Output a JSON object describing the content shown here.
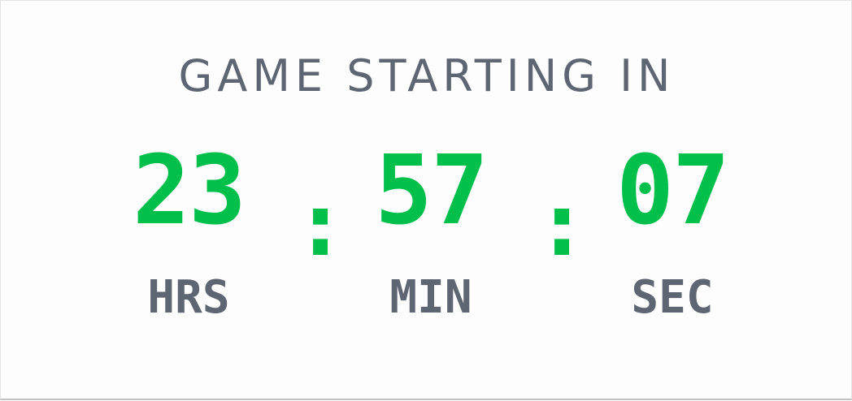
{
  "title": "GAME STARTING IN",
  "countdown": {
    "hours": {
      "value": "23",
      "label": "HRS"
    },
    "minutes": {
      "value": "57",
      "label": "MIN"
    },
    "seconds": {
      "value": "07",
      "label": "SEC"
    },
    "separator": ":"
  },
  "colors": {
    "accent": "#00c04b",
    "muted": "#5f6673",
    "background": "#fdfdfd"
  }
}
